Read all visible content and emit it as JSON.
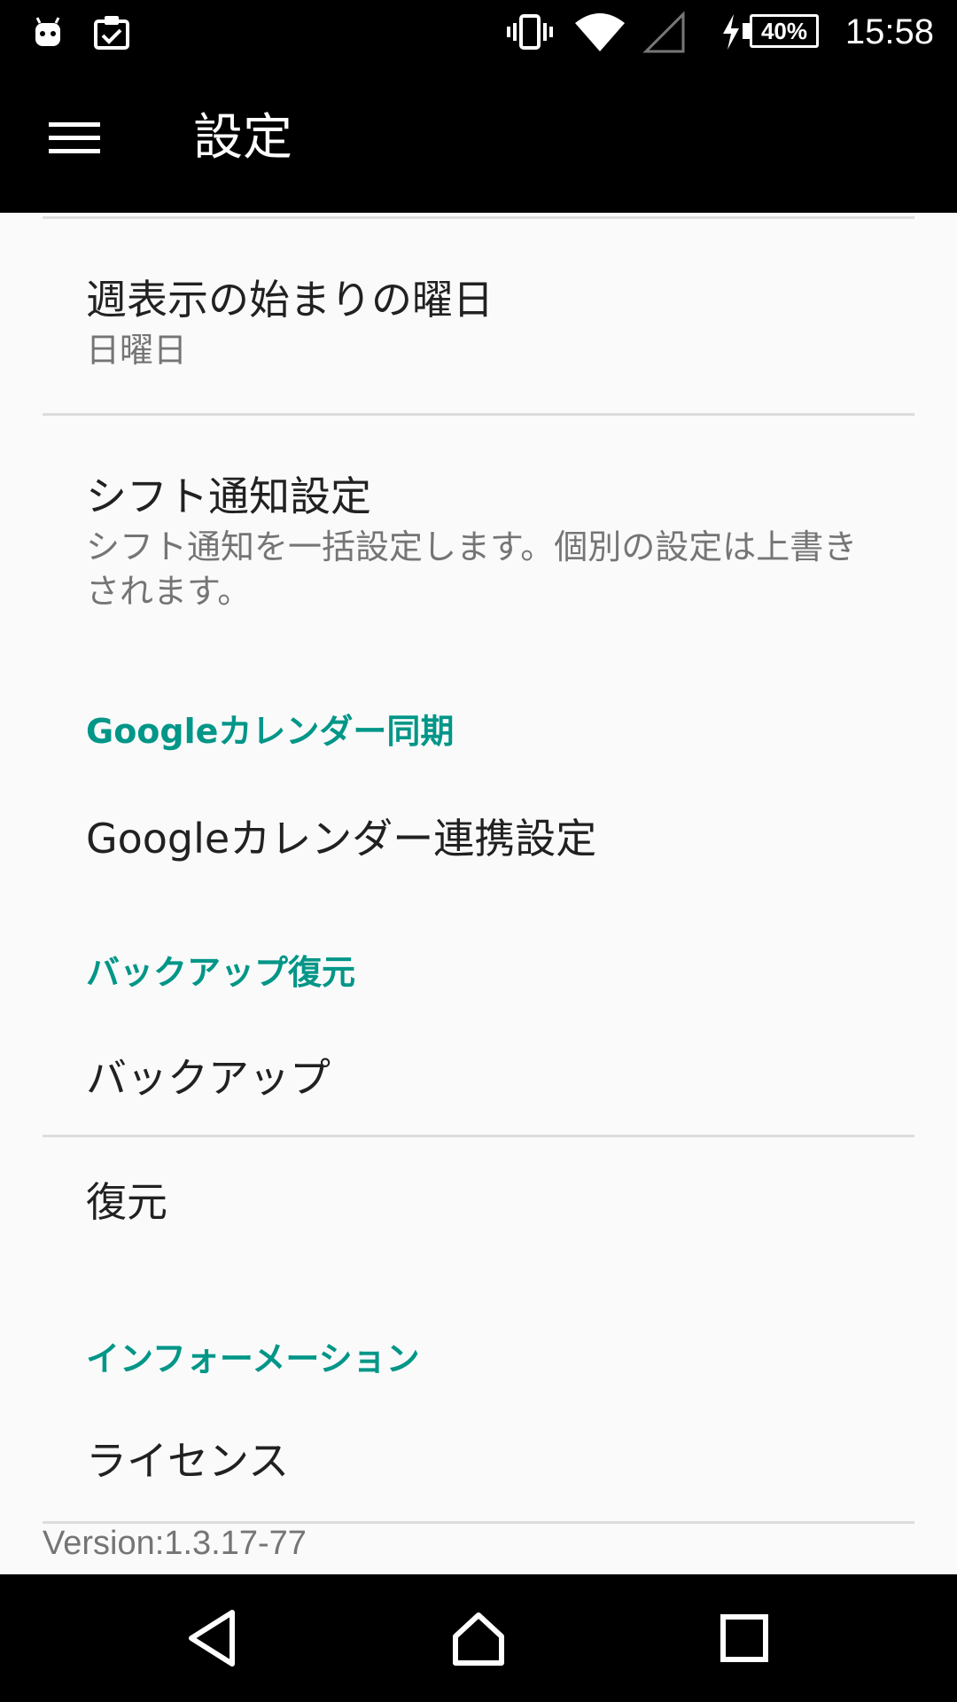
{
  "status_bar": {
    "time": "15:58",
    "battery_percent": "40%",
    "icons": [
      "android-icon",
      "clipboard-check-icon",
      "vibrate-icon",
      "wifi-icon",
      "cell-signal-icon",
      "charging-icon",
      "battery-icon"
    ]
  },
  "app_bar": {
    "title": "設定",
    "menu_icon": "hamburger-menu-icon"
  },
  "preferences": {
    "week_start": {
      "title": "週表示の始まりの曜日",
      "summary": "日曜日"
    },
    "shift_notification": {
      "title": "シフト通知設定",
      "summary": "シフト通知を一括設定します。個別の設定は上書きされます。"
    },
    "google_calendar": {
      "category": "Googleカレンダー同期",
      "link_title": "Googleカレンダー連携設定"
    },
    "backup_restore": {
      "category": "バックアップ復元",
      "backup_title": "バックアップ",
      "restore_title": "復元"
    },
    "information": {
      "category": "インフォーメーション",
      "license_title": "ライセンス"
    }
  },
  "version": "Version:1.3.17-77",
  "colors": {
    "accent": "#009688",
    "bars": "#000000",
    "background": "#fafafa",
    "primary_text": "#212121",
    "secondary_text": "#757575"
  },
  "nav_bar": {
    "icons": [
      "back-icon",
      "home-icon",
      "recents-icon"
    ]
  }
}
